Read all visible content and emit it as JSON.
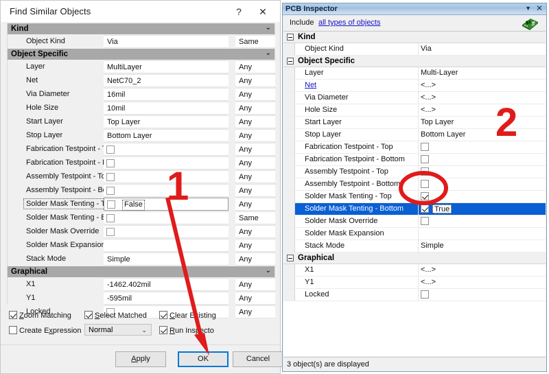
{
  "find_similar": {
    "title": "Find Similar Objects",
    "help_icon": "?",
    "close_icon": "✕",
    "sections": [
      {
        "name": "Kind",
        "chevron": "⌄",
        "rows": [
          {
            "label": "Object Kind",
            "value": "Via",
            "match": "Same",
            "type": "text"
          }
        ]
      },
      {
        "name": "Object Specific",
        "chevron": "⌄",
        "rows": [
          {
            "label": "Layer",
            "value": "MultiLayer",
            "match": "Any",
            "type": "text"
          },
          {
            "label": "Net",
            "value": "NetC70_2",
            "match": "Any",
            "type": "text"
          },
          {
            "label": "Via Diameter",
            "value": "16mil",
            "match": "Any",
            "type": "text"
          },
          {
            "label": "Hole Size",
            "value": "10mil",
            "match": "Any",
            "type": "text"
          },
          {
            "label": "Start Layer",
            "value": "Top Layer",
            "match": "Any",
            "type": "text"
          },
          {
            "label": "Stop Layer",
            "value": "Bottom Layer",
            "match": "Any",
            "type": "text"
          },
          {
            "label": "Fabrication Testpoint - T",
            "value": "",
            "match": "Any",
            "type": "checkbox",
            "checked": false
          },
          {
            "label": "Fabrication Testpoint - B",
            "value": "",
            "match": "Any",
            "type": "checkbox",
            "checked": false
          },
          {
            "label": "Assembly Testpoint - Top",
            "value": "",
            "match": "Any",
            "type": "checkbox",
            "checked": false
          },
          {
            "label": "Assembly Testpoint - Bot",
            "value": "",
            "match": "Any",
            "type": "checkbox",
            "checked": false
          },
          {
            "label": "Solder Mask Tenting - T",
            "value": "False",
            "match": "Any",
            "type": "checkbox",
            "checked": false,
            "focused": true,
            "editing": true
          },
          {
            "label": "Solder Mask Tenting - B",
            "value": "",
            "match": "Same",
            "type": "checkbox",
            "checked": false
          },
          {
            "label": "Solder Mask Override",
            "value": "",
            "match": "Any",
            "type": "checkbox",
            "checked": false
          },
          {
            "label": "Solder Mask Expansion",
            "value": "",
            "match": "Any",
            "type": "text"
          },
          {
            "label": "Stack Mode",
            "value": "Simple",
            "match": "Any",
            "type": "text"
          }
        ]
      },
      {
        "name": "Graphical",
        "chevron": "⌄",
        "rows": [
          {
            "label": "X1",
            "value": "-1462.402mil",
            "match": "Any",
            "type": "text"
          },
          {
            "label": "Y1",
            "value": "-595mil",
            "match": "Any",
            "type": "text"
          },
          {
            "label": "Locked",
            "value": "",
            "match": "Any",
            "type": "checkbox",
            "checked": false
          }
        ]
      }
    ],
    "options": [
      {
        "label": "Zoom Matching",
        "checked": true,
        "accel": "Z"
      },
      {
        "label": "Select Matched",
        "checked": true,
        "accel": "S"
      },
      {
        "label": "Clear Existing",
        "checked": true,
        "accel": "C"
      },
      {
        "label": "Create Expression",
        "checked": false,
        "accel": "x"
      },
      {
        "label": "Run Inspector",
        "checked": true,
        "accel": "R"
      }
    ],
    "mode_select": {
      "value": "Normal",
      "arrow": "⌄"
    },
    "buttons": [
      {
        "label": "Apply",
        "accel": "A",
        "focused": false
      },
      {
        "label": "OK",
        "accel": "",
        "focused": true
      },
      {
        "label": "Cancel",
        "accel": "",
        "focused": false
      }
    ]
  },
  "inspector": {
    "title": "PCB Inspector",
    "dropdown_icon": "▼",
    "close_icon": "✕",
    "include_label": "Include",
    "include_link": "all types of objects",
    "board_icon": "pcb-board-icon",
    "sections": [
      {
        "name": "Kind",
        "expander": "minus",
        "rows": [
          {
            "label": "Object Kind",
            "value": "Via",
            "type": "text"
          }
        ]
      },
      {
        "name": "Object Specific",
        "expander": "minus",
        "rows": [
          {
            "label": "Layer",
            "value": "Multi-Layer",
            "type": "text"
          },
          {
            "label": "Net",
            "value": "<...>",
            "type": "text",
            "link": true
          },
          {
            "label": "Via Diameter",
            "value": "<...>",
            "type": "text"
          },
          {
            "label": "Hole Size",
            "value": "<...>",
            "type": "text"
          },
          {
            "label": "Start Layer",
            "value": "Top Layer",
            "type": "text"
          },
          {
            "label": "Stop Layer",
            "value": "Bottom Layer",
            "type": "text"
          },
          {
            "label": "Fabrication Testpoint - Top",
            "value": "",
            "type": "checkbox",
            "checked": false
          },
          {
            "label": "Fabrication Testpoint - Bottom",
            "value": "",
            "type": "checkbox",
            "checked": false
          },
          {
            "label": "Assembly Testpoint - Top",
            "value": "",
            "type": "checkbox",
            "checked": false
          },
          {
            "label": "Assembly Testpoint - Bottom",
            "value": "",
            "type": "checkbox",
            "checked": false
          },
          {
            "label": "Solder Mask Tenting - Top",
            "value": "",
            "type": "checkbox",
            "checked": true
          },
          {
            "label": "Solder Mask Tenting - Bottom",
            "value": "True",
            "type": "checkbox",
            "checked": true,
            "selected": true
          },
          {
            "label": "Solder Mask Override",
            "value": "",
            "type": "checkbox",
            "checked": false
          },
          {
            "label": "Solder Mask Expansion",
            "value": "",
            "type": "text"
          },
          {
            "label": "Stack Mode",
            "value": "Simple",
            "type": "text"
          }
        ]
      },
      {
        "name": "Graphical",
        "expander": "minus",
        "rows": [
          {
            "label": "X1",
            "value": "<...>",
            "type": "text"
          },
          {
            "label": "Y1",
            "value": "<...>",
            "type": "text"
          },
          {
            "label": "Locked",
            "value": "",
            "type": "checkbox",
            "checked": false
          }
        ]
      }
    ],
    "status": "3 object(s) are displayed"
  },
  "annotations": {
    "step_one": "1",
    "step_two": "2",
    "accent_color": "#e01b1b"
  }
}
